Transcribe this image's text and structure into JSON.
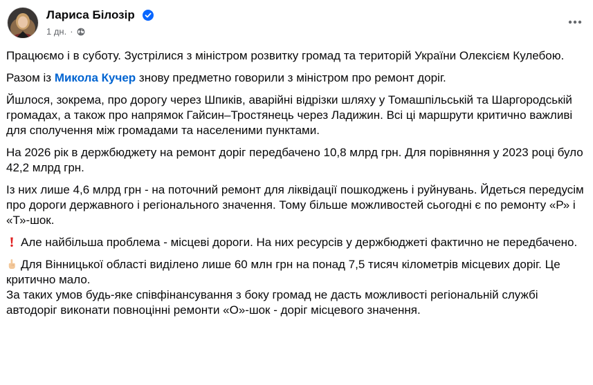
{
  "post": {
    "author": "Лариса Білозір",
    "time": "1 дн.",
    "dot": "·",
    "icons": {
      "verified": "verified-badge-icon",
      "audience": "globe-icon",
      "more": "more-horizontal-icon",
      "exclamation": "red-exclamation-icon",
      "hand": "pointing-up-hand-icon"
    },
    "paragraphs": {
      "p1": "Працюємо і в суботу. Зустрілися з міністром розвитку громад та територій України Олексієм Кулебою.",
      "p2_before": "Разом із ",
      "p2_mention": "Микола Кучер",
      "p2_after": " знову предметно говорили з міністром про ремонт доріг.",
      "p3": "Йшлося, зокрема, про дорогу через Шпиків, аварійні відрізки шляху у Томашпільській та Шаргородській громадах, а також про напрямок Гайсин–Тростянець через Ладижин. Всі ці маршрути критично важливі для сполучення між громадами та населеними пунктами.",
      "p4": "На 2026 рік в держбюджету на ремонт доріг передбачено 10,8 млрд грн. Для порівняння у 2023 році було 42,2 млрд грн.",
      "p5": "Із них лише 4,6 млрд грн - на поточний ремонт для ліквідації пошкоджень і руйнувань. Йдеться передусім про дороги державного і регіонального значення. Тому більше можливостей сьогодні є по ремонту «Р» і «Т»-шок.",
      "p6": "Але найбільша проблема - місцеві дороги. На них ресурсів у держбюджеті фактично не передбачено.",
      "p7": "Для Вінницької області виділено лише 60 млн грн на понад 7,5 тисяч кілометрів місцевих доріг. Це критично мало.",
      "p8": "За таких умов будь-яке співфінансування з боку громад не дасть можливості регіональній службі автодоріг виконати повноцінні ремонти «О»-шок - доріг місцевого значення."
    }
  },
  "colors": {
    "link": "#0064d1",
    "verified": "#0866ff",
    "meta": "#65686c",
    "exclamation": "#e02020"
  }
}
